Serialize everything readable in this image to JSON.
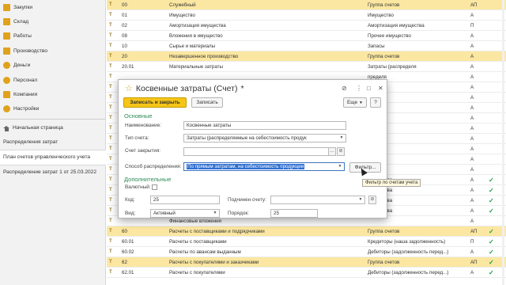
{
  "sidebar": {
    "menu": [
      {
        "label": "Закупки",
        "icon": "cart-icon"
      },
      {
        "label": "Склад",
        "icon": "warehouse-icon"
      },
      {
        "label": "Работы",
        "icon": "work-icon"
      },
      {
        "label": "Производство",
        "icon": "factory-icon"
      },
      {
        "label": "Деньги",
        "icon": "money-icon"
      },
      {
        "label": "Персонал",
        "icon": "people-icon"
      },
      {
        "label": "Компания",
        "icon": "company-icon"
      },
      {
        "label": "Настройки",
        "icon": "gear-icon"
      }
    ],
    "tabs": [
      "Начальная страница",
      "Распределения затрат",
      "План счетов управленческого учета",
      "Распределение затрат 1 от 25.03.2022"
    ]
  },
  "rows": [
    {
      "code": "00",
      "name": "Служебный",
      "type": "Группа счетов",
      "ap": "АП",
      "group": true,
      "check": false
    },
    {
      "code": "01",
      "name": "Имущество",
      "type": "Имущество",
      "ap": "А",
      "group": false,
      "check": false
    },
    {
      "code": "02",
      "name": "Амортизация имущества",
      "type": "Амортизация имущества",
      "ap": "П",
      "group": false,
      "check": false
    },
    {
      "code": "08",
      "name": "Вложения в имущество",
      "type": "Прочее имущество",
      "ap": "А",
      "group": false,
      "check": false
    },
    {
      "code": "10",
      "name": "Сырье и материалы",
      "type": "Запасы",
      "ap": "А",
      "group": false,
      "check": false
    },
    {
      "code": "20",
      "name": "Незавершенное производство",
      "type": "Группа счетов",
      "ap": "А",
      "group": true,
      "check": false
    },
    {
      "code": "20.01",
      "name": "Материальные затраты",
      "type": "Затраты (распределя",
      "ap": "А",
      "group": false,
      "check": false
    },
    {
      "code": "",
      "name": "",
      "type": "пределя",
      "ap": "А",
      "group": false,
      "check": false
    },
    {
      "code": "",
      "name": "",
      "type": "пределя",
      "ap": "А",
      "group": false,
      "check": false
    },
    {
      "code": "",
      "name": "",
      "type": "пределя",
      "ap": "А",
      "group": false,
      "check": false
    },
    {
      "code": "",
      "name": "",
      "type": "пределя",
      "ap": "А",
      "group": false,
      "check": false
    },
    {
      "code": "",
      "name": "",
      "type": "пределя",
      "ap": "А",
      "group": false,
      "check": false
    },
    {
      "code": "",
      "name": "",
      "type": "пределя",
      "ap": "А",
      "group": false,
      "check": false
    },
    {
      "code": "",
      "name": "",
      "type": "",
      "ap": "А",
      "group": false,
      "check": false
    },
    {
      "code": "",
      "name": "",
      "type": "",
      "ap": "А",
      "group": false,
      "check": false
    },
    {
      "code": "",
      "name": "",
      "type": "",
      "ap": "А",
      "group": false,
      "check": false
    },
    {
      "code": "",
      "name": "",
      "type": "изнка",
      "ap": "А",
      "group": false,
      "check": false
    },
    {
      "code": "",
      "name": "",
      "type": "е средства",
      "ap": "А",
      "group": false,
      "check": true
    },
    {
      "code": "",
      "name": "",
      "type": "е средства",
      "ap": "А",
      "group": false,
      "check": true
    },
    {
      "code": "",
      "name": "",
      "type": "е средства",
      "ap": "А",
      "group": false,
      "check": true
    },
    {
      "code": "",
      "name": "",
      "type": "е средства",
      "ap": "А",
      "group": false,
      "check": true
    },
    {
      "code": "",
      "name": "Финансовые вложения",
      "type": "",
      "ap": "А",
      "group": false,
      "check": false
    },
    {
      "code": "60",
      "name": "Расчеты с поставщиками и подрядчиками",
      "type": "Группа счетов",
      "ap": "АП",
      "group": true,
      "check": true
    },
    {
      "code": "60.01",
      "name": "Расчеты с поставщиками",
      "type": "Кредиторы (наша задолженность)",
      "ap": "П",
      "group": false,
      "check": true
    },
    {
      "code": "60.02",
      "name": "Расчеты по авансам выданным",
      "type": "Дебиторы (задолженность перед...)",
      "ap": "А",
      "group": false,
      "check": true
    },
    {
      "code": "62",
      "name": "Расчеты с покупателями и заказчиками",
      "type": "Группа счетов",
      "ap": "АП",
      "group": true,
      "check": true
    },
    {
      "code": "62.01",
      "name": "Расчеты с покупателями",
      "type": "Дебиторы (задолженность перед...)",
      "ap": "А",
      "group": false,
      "check": true
    }
  ],
  "dialog": {
    "title": "Косвенные затраты (Счет)",
    "star": "*",
    "controls": {
      "link": "⊘",
      "more": "⋮",
      "max": "□",
      "close": "✕"
    },
    "save_close": "Записать и закрыть",
    "save": "Записать",
    "more_btn": "Еще",
    "help": "?",
    "section_main": "Основные",
    "name_label": "Наименование:",
    "name_value": "Косвенные затраты",
    "type_label": "Тип счета:",
    "type_value": "Затраты (распределяемые на себестоимость продук",
    "close_label": "Счет закрытия:",
    "close_value": "",
    "method_label": "Способ распределения:",
    "method_value": "По прямым затратам, на себестоимость продукции",
    "filter_btn": "Фильтр...",
    "section_extra": "Дополнительные",
    "currency_label": "Валютный:",
    "code_label": "Код:",
    "code_value": "25",
    "parent_label": "Подчинен счету:",
    "parent_value": "",
    "kind_label": "Вид:",
    "kind_value": "Активный",
    "order_label": "Порядок:",
    "order_value": "25"
  },
  "tooltip": "Фильтр по счетам учета"
}
